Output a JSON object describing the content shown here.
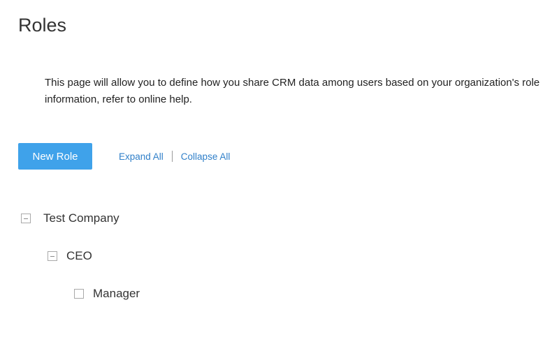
{
  "page": {
    "title": "Roles",
    "description_line1": "This page will allow you to define how you share CRM data among users based on your organization's role",
    "description_line2": "information, refer to online help."
  },
  "toolbar": {
    "new_role_label": "New Role",
    "expand_all_label": "Expand All",
    "collapse_all_label": "Collapse All"
  },
  "tree": {
    "root": {
      "label": "Test Company",
      "state": "expanded"
    },
    "ceo": {
      "label": "CEO",
      "state": "expanded"
    },
    "manager": {
      "label": "Manager",
      "state": "leaf"
    }
  },
  "colors": {
    "accent": "#3fa2ea",
    "link": "#2f7fc9"
  }
}
